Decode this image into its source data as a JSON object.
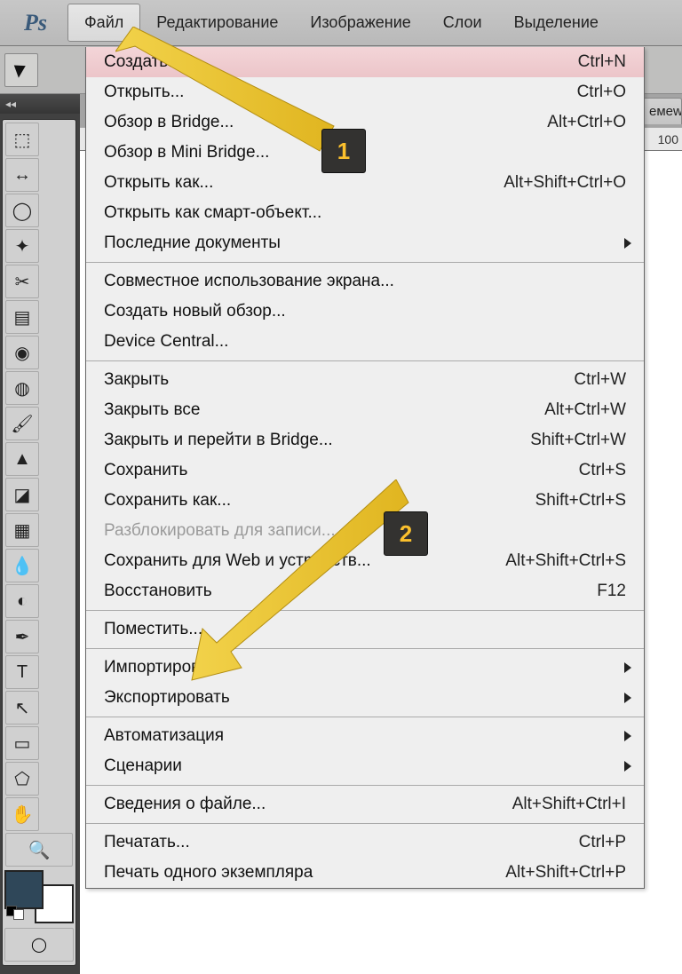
{
  "app": {
    "logo_text": "Ps"
  },
  "menubar": {
    "file": "Файл",
    "edit": "Редактирование",
    "image": "Изображение",
    "layers": "Слои",
    "select": "Выделение"
  },
  "doc": {
    "tab_fragment": "емеws_",
    "ruler_value": "100"
  },
  "left_collapse": "◂◂",
  "dropdown": {
    "create": {
      "label": "Создать...",
      "shortcut": "Ctrl+N"
    },
    "open": {
      "label": "Открыть...",
      "shortcut": "Ctrl+O"
    },
    "browse_bridge": {
      "label": "Обзор в Bridge...",
      "shortcut": "Alt+Ctrl+O"
    },
    "browse_mini_bridge": {
      "label": "Обзор в Mini Bridge..."
    },
    "open_as": {
      "label": "Открыть как...",
      "shortcut": "Alt+Shift+Ctrl+O"
    },
    "open_smart": {
      "label": "Открыть как смарт-объект..."
    },
    "recent": {
      "label": "Последние документы"
    },
    "share_screen": {
      "label": "Совместное использование экрана..."
    },
    "new_review": {
      "label": "Создать новый обзор..."
    },
    "device_central": {
      "label": "Device Central..."
    },
    "close": {
      "label": "Закрыть",
      "shortcut": "Ctrl+W"
    },
    "close_all": {
      "label": "Закрыть все",
      "shortcut": "Alt+Ctrl+W"
    },
    "close_bridge": {
      "label": "Закрыть и перейти в Bridge...",
      "shortcut": "Shift+Ctrl+W"
    },
    "save": {
      "label": "Сохранить",
      "shortcut": "Ctrl+S"
    },
    "save_as": {
      "label": "Сохранить как...",
      "shortcut": "Shift+Ctrl+S"
    },
    "unlock_save": {
      "label": "Разблокировать для записи..."
    },
    "save_web": {
      "label": "Сохранить для Web и устройств...",
      "shortcut": "Alt+Shift+Ctrl+S"
    },
    "revert": {
      "label": "Восстановить",
      "shortcut": "F12"
    },
    "place": {
      "label": "Поместить..."
    },
    "import": {
      "label": "Импортировать"
    },
    "export": {
      "label": "Экспортировать"
    },
    "automate": {
      "label": "Автоматизация"
    },
    "scripts": {
      "label": "Сценарии"
    },
    "file_info": {
      "label": "Сведения о файле...",
      "shortcut": "Alt+Shift+Ctrl+I"
    },
    "print": {
      "label": "Печатать...",
      "shortcut": "Ctrl+P"
    },
    "print_one": {
      "label": "Печать одного экземпляра",
      "shortcut": "Alt+Shift+Ctrl+P"
    }
  },
  "badges": {
    "one": "1",
    "two": "2"
  },
  "tool_glyphs": {
    "marquee": "⬚",
    "move": "↔",
    "lasso": "◯",
    "wand": "✦",
    "crop": "✂",
    "slice": "▤",
    "eyedrop": "◉",
    "heal": "◍",
    "brush": "🖌",
    "stamp": "▲",
    "eraser": "◪",
    "grad": "▦",
    "blur": "💧",
    "dodge": "◐",
    "pen": "✒",
    "type": "T",
    "path": "↖",
    "shape": "▭",
    "shape2": "⬠",
    "hand": "✋",
    "zoom": "🔍",
    "quickmask": "◯"
  }
}
